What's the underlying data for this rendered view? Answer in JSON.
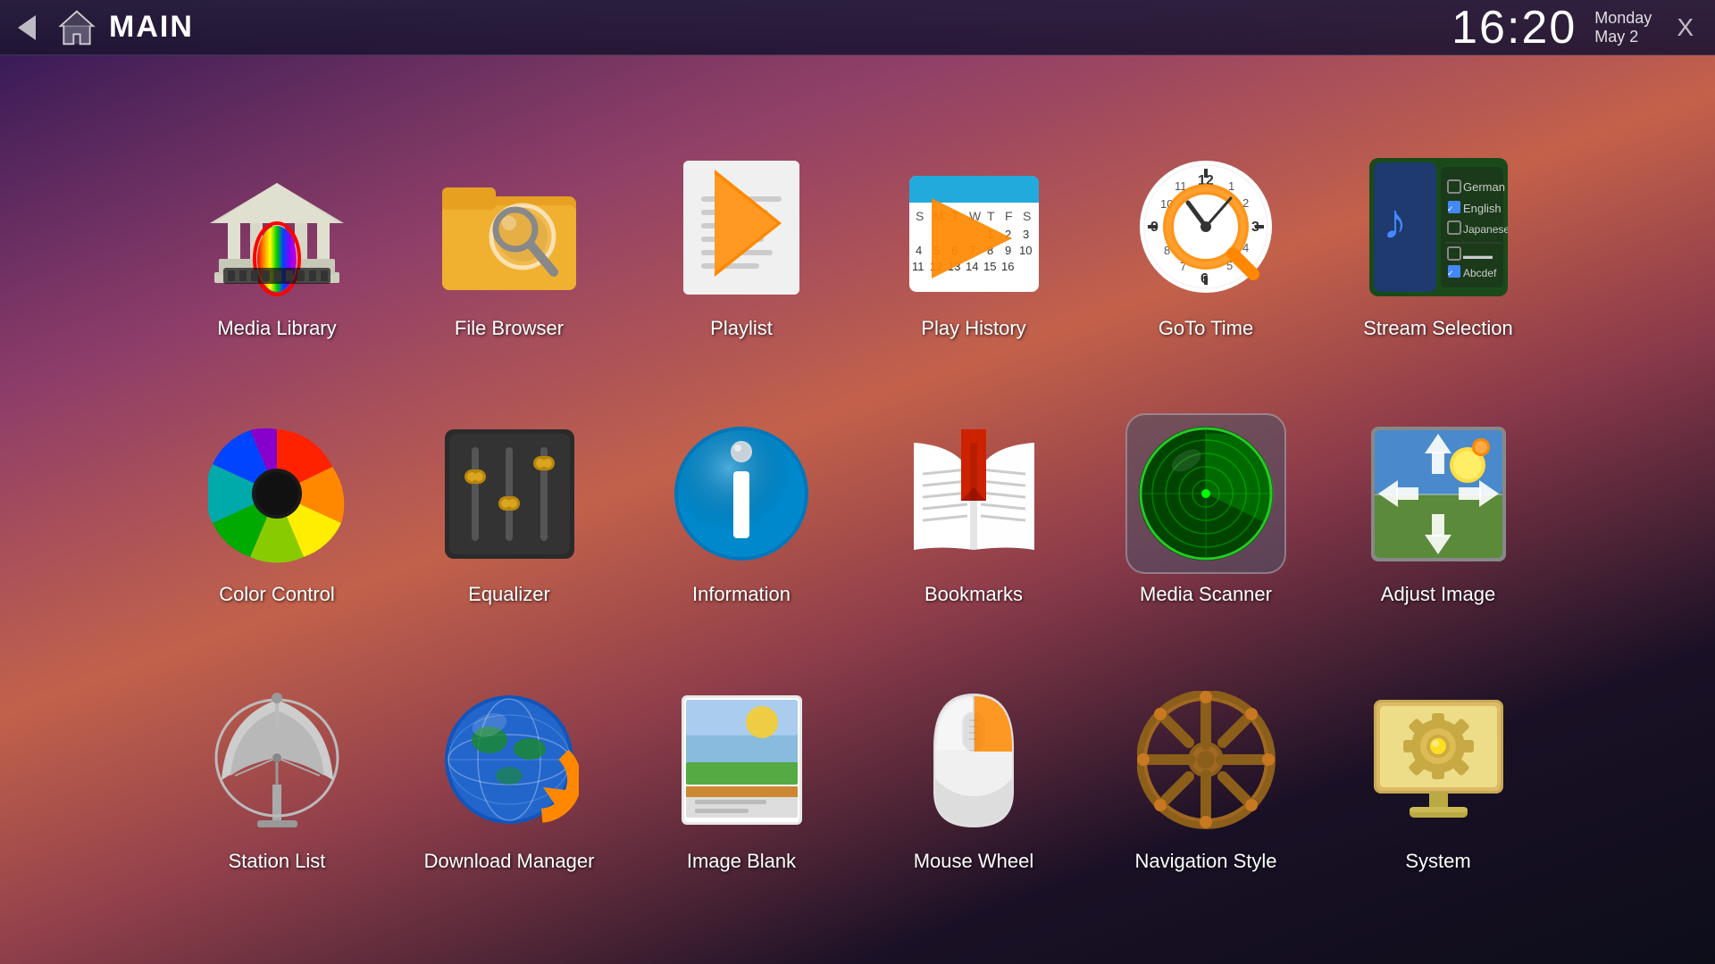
{
  "header": {
    "title": "MAIN",
    "clock": "16:20",
    "day": "Monday",
    "date": "May 2",
    "back_label": "back",
    "close_label": "X"
  },
  "grid": {
    "rows": [
      [
        {
          "id": "media-library",
          "label": "Media Library"
        },
        {
          "id": "file-browser",
          "label": "File Browser"
        },
        {
          "id": "playlist",
          "label": "Playlist"
        },
        {
          "id": "play-history",
          "label": "Play History"
        },
        {
          "id": "goto-time",
          "label": "GoTo Time"
        },
        {
          "id": "stream-selection",
          "label": "Stream Selection"
        }
      ],
      [
        {
          "id": "color-control",
          "label": "Color Control"
        },
        {
          "id": "equalizer",
          "label": "Equalizer"
        },
        {
          "id": "information",
          "label": "Information"
        },
        {
          "id": "bookmarks",
          "label": "Bookmarks"
        },
        {
          "id": "media-scanner",
          "label": "Media Scanner",
          "selected": true
        },
        {
          "id": "adjust-image",
          "label": "Adjust Image"
        }
      ],
      [
        {
          "id": "station-list",
          "label": "Station List"
        },
        {
          "id": "download-manager",
          "label": "Download Manager"
        },
        {
          "id": "image-blank",
          "label": "Image Blank"
        },
        {
          "id": "mouse-wheel",
          "label": "Mouse Wheel"
        },
        {
          "id": "navigation-style",
          "label": "Navigation Style"
        },
        {
          "id": "system",
          "label": "System"
        }
      ]
    ]
  }
}
